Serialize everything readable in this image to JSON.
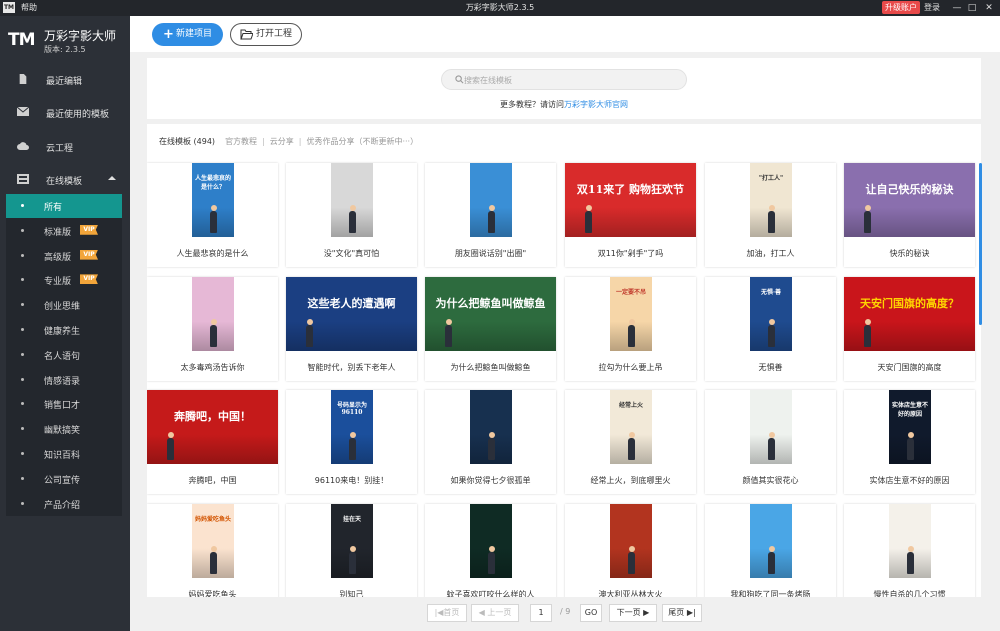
{
  "window": {
    "logo_text": "TM",
    "help_menu": "帮助",
    "title": "万彩字影大师2.3.5",
    "upgrade_label": "升级账户",
    "login_label": "登录"
  },
  "brand": {
    "mark": "TM",
    "name": "万彩字影大师",
    "version": "版本: 2.3.5"
  },
  "sidebar": {
    "items": [
      {
        "label": "最近编辑",
        "icon": "document-icon"
      },
      {
        "label": "最近使用的模板",
        "icon": "envelope-icon"
      },
      {
        "label": "云工程",
        "icon": "cloud-icon"
      },
      {
        "label": "在线模板",
        "icon": "template-icon"
      }
    ],
    "sub_items": [
      {
        "label": "所有",
        "vip": ""
      },
      {
        "label": "标准版",
        "vip": "VIP"
      },
      {
        "label": "高级版",
        "vip": "VIP"
      },
      {
        "label": "专业版",
        "vip": "VIP"
      },
      {
        "label": "创业思维",
        "vip": ""
      },
      {
        "label": "健康养生",
        "vip": ""
      },
      {
        "label": "名人语句",
        "vip": ""
      },
      {
        "label": "情感语录",
        "vip": ""
      },
      {
        "label": "销售口才",
        "vip": ""
      },
      {
        "label": "幽默搞笑",
        "vip": ""
      },
      {
        "label": "知识百科",
        "vip": ""
      },
      {
        "label": "公司宣传",
        "vip": ""
      },
      {
        "label": "产品介绍",
        "vip": ""
      }
    ]
  },
  "toolbar": {
    "new_project": "新建项目",
    "open_project": "打开工程"
  },
  "search": {
    "placeholder": "搜索在线模板",
    "help_prefix": "更多教程？请访问",
    "help_link": "万彩字影大师官网"
  },
  "tabs": [
    {
      "label": "在线模板 (494)",
      "current": true
    },
    {
      "label": "官方教程",
      "current": false
    },
    {
      "label": "云分享",
      "current": false
    },
    {
      "label": "优秀作品分享（不断更新中···）",
      "current": false
    }
  ],
  "templates": [
    {
      "title": "人生最悲哀的是什么",
      "thumb_text": "人生最悲哀的是什么？",
      "bg": "#2e7fc9",
      "fg": "#ffffff",
      "style": "portrait"
    },
    {
      "title": "没\"文化\"真可怕",
      "thumb_text": "",
      "bg": "#d8d8d8",
      "fg": "#333333",
      "style": "portrait"
    },
    {
      "title": "朋友圈说话别\"出圈\"",
      "thumb_text": "",
      "bg": "#3a8fd6",
      "fg": "#ffffff",
      "style": "portrait"
    },
    {
      "title": "双11你\"剁手\"了吗",
      "thumb_text": "双11来了 购物狂欢节",
      "bg": "#d92b2b",
      "fg": "#ffffff",
      "style": "wide"
    },
    {
      "title": "加油，打工人",
      "thumb_text": "\"打工人\"",
      "bg": "#f0e6d2",
      "fg": "#333333",
      "style": "portrait"
    },
    {
      "title": "快乐的秘诀",
      "thumb_text": "让自己快乐的秘诀",
      "bg": "#8a6fae",
      "fg": "#ffffff",
      "style": "wide"
    },
    {
      "title": "太多毒鸡汤告诉你",
      "thumb_text": "",
      "bg": "#e6b8d6",
      "fg": "#ffffff",
      "style": "portrait"
    },
    {
      "title": "智能时代，别丢下老年人",
      "thumb_text": "这些老人的遭遇啊",
      "bg": "#1b3f82",
      "fg": "#ffffff",
      "style": "wide"
    },
    {
      "title": "为什么把鲸鱼叫做鲸鱼",
      "thumb_text": "为什么把鲸鱼叫做鲸鱼",
      "bg": "#2d6b3e",
      "fg": "#ffffff",
      "style": "wide"
    },
    {
      "title": "拉勾为什么要上吊",
      "thumb_text": "一定要不吊",
      "bg": "#f6d6a8",
      "fg": "#c0392b",
      "style": "portrait"
    },
    {
      "title": "无惧善",
      "thumb_text": "无惧·善",
      "bg": "#1f4b8f",
      "fg": "#ffffff",
      "style": "portrait"
    },
    {
      "title": "天安门国旗的高度",
      "thumb_text": "天安门国旗的高度？",
      "bg": "#c9151b",
      "fg": "#ffd400",
      "style": "wide"
    },
    {
      "title": "奔腾吧，中国",
      "thumb_text": "奔腾吧，中国！",
      "bg": "#c51a1a",
      "fg": "#ffffff",
      "style": "wide"
    },
    {
      "title": "96110来电！别挂！",
      "thumb_text": "号码显示为 96110",
      "bg": "#1b4f9c",
      "fg": "#ffffff",
      "style": "portrait"
    },
    {
      "title": "如果你觉得七夕很孤单",
      "thumb_text": "",
      "bg": "#17304f",
      "fg": "#ffffff",
      "style": "portrait"
    },
    {
      "title": "经常上火，到底哪里火",
      "thumb_text": "经常上火",
      "bg": "#f2e9d8",
      "fg": "#333333",
      "style": "portrait"
    },
    {
      "title": "颜值其实很花心",
      "thumb_text": "",
      "bg": "#eef2ee",
      "fg": "#333333",
      "style": "portrait"
    },
    {
      "title": "实体店生意不好的原因",
      "thumb_text": "实体店生意不好的原因",
      "bg": "#101a2c",
      "fg": "#ffffff",
      "style": "portrait"
    },
    {
      "title": "妈妈爱吃鱼头",
      "thumb_text": "妈妈爱吃鱼头",
      "bg": "#fbe3cf",
      "fg": "#d35400",
      "style": "portrait"
    },
    {
      "title": "别知己",
      "thumb_text": "挂在天",
      "bg": "#21252c",
      "fg": "#ffffff",
      "style": "portrait"
    },
    {
      "title": "蚊子喜欢叮咬什么样的人",
      "thumb_text": "",
      "bg": "#0f2b24",
      "fg": "#ffffff",
      "style": "portrait"
    },
    {
      "title": "澳大利亚丛林大火",
      "thumb_text": "",
      "bg": "#b2341f",
      "fg": "#ffffff",
      "style": "portrait"
    },
    {
      "title": "我和狗吃了同一条烤肠",
      "thumb_text": "",
      "bg": "#4aa6e6",
      "fg": "#ffffff",
      "style": "portrait"
    },
    {
      "title": "慢性自杀的几个习惯",
      "thumb_text": "",
      "bg": "#f4f1ea",
      "fg": "#333333",
      "style": "portrait"
    }
  ],
  "pagination": {
    "first": "|◀首页",
    "prev": "◀ 上一页",
    "current": "1",
    "total": "/ 9",
    "go": "GO",
    "next": "下一页 ▶",
    "last": "尾页 ▶|"
  }
}
